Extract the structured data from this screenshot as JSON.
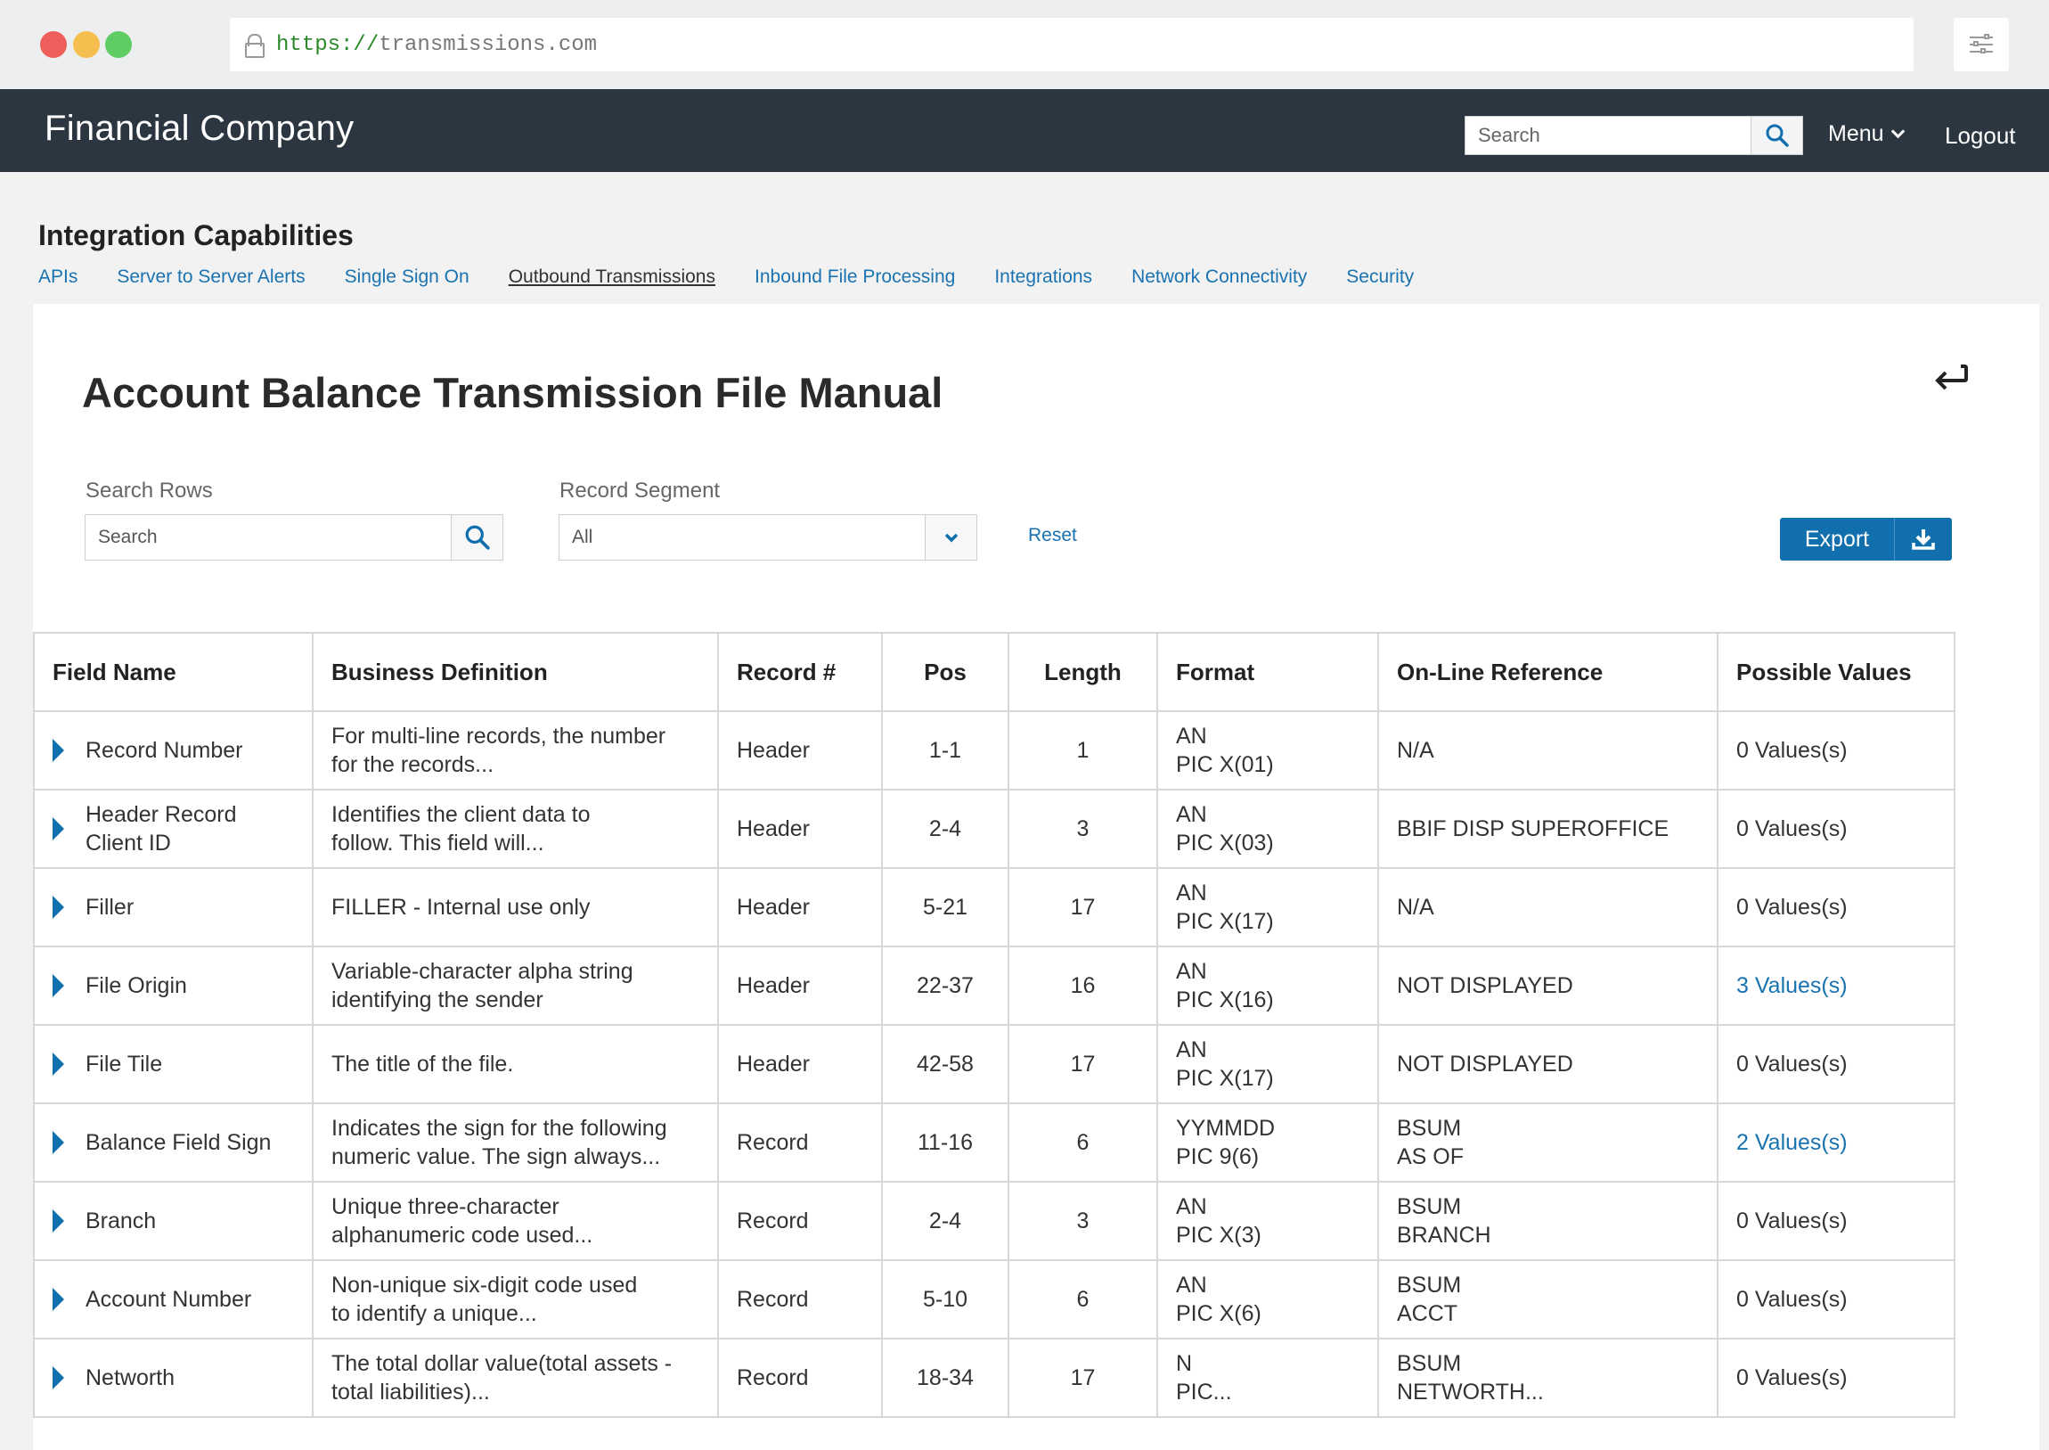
{
  "browser": {
    "url_scheme": "https://",
    "url_host": "transmissions.com"
  },
  "header": {
    "brand": "Financial Company",
    "search_placeholder": "Search",
    "menu_label": "Menu",
    "logout_label": "Logout"
  },
  "section": {
    "title": "Integration Capabilities",
    "nav": [
      {
        "label": "APIs",
        "active": false
      },
      {
        "label": "Server to Server Alerts",
        "active": false
      },
      {
        "label": "Single Sign On",
        "active": false
      },
      {
        "label": "Outbound Transmissions",
        "active": true
      },
      {
        "label": "Inbound File Processing",
        "active": false
      },
      {
        "label": "Integrations",
        "active": false
      },
      {
        "label": "Network Connectivity",
        "active": false
      },
      {
        "label": "Security",
        "active": false
      }
    ]
  },
  "page": {
    "title": "Account Balance Transmission File Manual",
    "search_rows_label": "Search Rows",
    "search_rows_placeholder": "Search",
    "segment_label": "Record Segment",
    "segment_value": "All",
    "reset_label": "Reset",
    "export_label": "Export"
  },
  "table": {
    "headers": [
      "Field Name",
      "Business Definition",
      "Record #",
      "Pos",
      "Length",
      "Format",
      "On-Line Reference",
      "Possible Values"
    ],
    "rows": [
      {
        "field": [
          "Record Number"
        ],
        "def": [
          "For multi-line records, the number",
          "for the records..."
        ],
        "record": "Header",
        "pos": "1-1",
        "length": "1",
        "format": [
          "AN",
          "PIC X(01)"
        ],
        "ref": [
          "N/A"
        ],
        "values": "0 Values(s)",
        "values_link": false
      },
      {
        "field": [
          "Header Record",
          "Client ID"
        ],
        "def": [
          "Identifies the client data to",
          "follow. This field will..."
        ],
        "record": "Header",
        "pos": "2-4",
        "length": "3",
        "format": [
          "AN",
          "PIC X(03)"
        ],
        "ref": [
          "BBIF DISP SUPEROFFICE"
        ],
        "values": "0 Values(s)",
        "values_link": false
      },
      {
        "field": [
          "Filler"
        ],
        "def": [
          "FILLER - Internal use only"
        ],
        "record": "Header",
        "pos": "5-21",
        "length": "17",
        "format": [
          "AN",
          "PIC X(17)"
        ],
        "ref": [
          "N/A"
        ],
        "values": "0 Values(s)",
        "values_link": false
      },
      {
        "field": [
          "File Origin"
        ],
        "def": [
          "Variable-character alpha string",
          "identifying the sender"
        ],
        "record": "Header",
        "pos": "22-37",
        "length": "16",
        "format": [
          "AN",
          "PIC X(16)"
        ],
        "ref": [
          "NOT DISPLAYED"
        ],
        "values": "3 Values(s)",
        "values_link": true
      },
      {
        "field": [
          "File Tile"
        ],
        "def": [
          "The title of the file."
        ],
        "record": "Header",
        "pos": "42-58",
        "length": "17",
        "format": [
          "AN",
          "PIC X(17)"
        ],
        "ref": [
          "NOT DISPLAYED"
        ],
        "values": "0 Values(s)",
        "values_link": false
      },
      {
        "field": [
          "Balance Field Sign"
        ],
        "def": [
          "Indicates the sign for the following",
          "numeric value. The sign always..."
        ],
        "record": "Record",
        "pos": "11-16",
        "length": "6",
        "format": [
          "YYMMDD",
          "PIC 9(6)"
        ],
        "ref": [
          "BSUM",
          "AS OF"
        ],
        "values": "2 Values(s)",
        "values_link": true
      },
      {
        "field": [
          "Branch"
        ],
        "def": [
          "Unique three-character",
          "alphanumeric code used..."
        ],
        "record": "Record",
        "pos": "2-4",
        "length": "3",
        "format": [
          "AN",
          "PIC X(3)"
        ],
        "ref": [
          "BSUM",
          "BRANCH"
        ],
        "values": "0 Values(s)",
        "values_link": false
      },
      {
        "field": [
          "Account Number"
        ],
        "def": [
          "Non-unique six-digit code used",
          "to identify a unique..."
        ],
        "record": "Record",
        "pos": "5-10",
        "length": "6",
        "format": [
          "AN",
          "PIC X(6)"
        ],
        "ref": [
          "BSUM",
          "ACCT"
        ],
        "values": "0 Values(s)",
        "values_link": false
      },
      {
        "field": [
          "Networth"
        ],
        "def": [
          "The total dollar value(total assets -",
          "total liabilities)..."
        ],
        "record": "Record",
        "pos": "18-34",
        "length": "17",
        "format": [
          "N",
          "PIC..."
        ],
        "ref": [
          "BSUM",
          "NETWORTH..."
        ],
        "values": "0 Values(s)",
        "values_link": false
      }
    ]
  },
  "colors": {
    "header_bg": "#2b3640",
    "accent": "#116fae",
    "link": "#1a73b0"
  },
  "icons": [
    "lock-icon",
    "sliders-icon",
    "search-icon",
    "chevron-down-icon",
    "return-arrow-icon",
    "download-icon",
    "expand-triangle-icon"
  ]
}
